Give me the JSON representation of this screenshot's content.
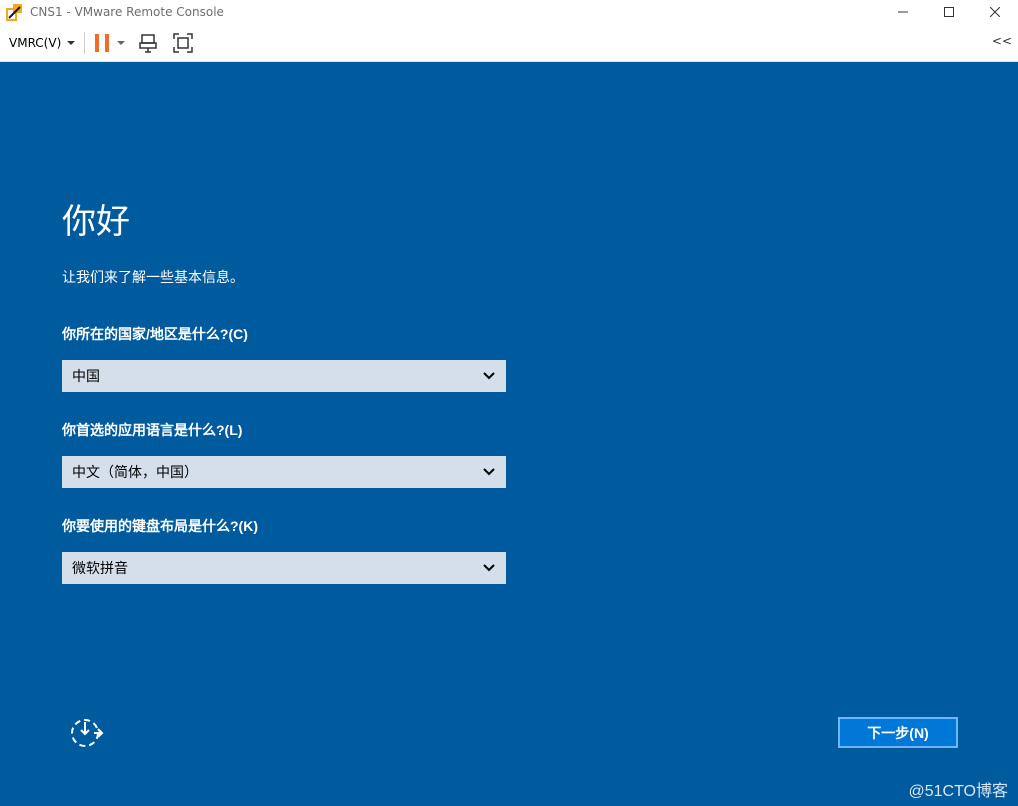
{
  "window": {
    "title": "CNS1 - VMware Remote Console",
    "controls": {
      "minimize_icon": "minimize-icon",
      "maximize_icon": "maximize-icon",
      "close_icon": "close-icon"
    }
  },
  "toolbar": {
    "vmrc_menu_label": "VMRC(V)",
    "pause_icon": "pause-icon",
    "send_ctrl_alt_del_icon": "send-ctrl-alt-del-icon",
    "fullscreen_icon": "fullscreen-icon",
    "collapse_label": "<<"
  },
  "setup": {
    "greeting": "你好",
    "subtitle": "让我们来了解一些基本信息。",
    "country": {
      "label": "你所在的国家/地区是什么?(C)",
      "value": "中国"
    },
    "language": {
      "label": "你首选的应用语言是什么?(L)",
      "value": "中文（简体，中国）"
    },
    "keyboard": {
      "label": "你要使用的键盘布局是什么?(K)",
      "value": "微软拼音"
    },
    "next_button": "下一步(N)",
    "accessibility_icon": "ease-of-access-icon"
  },
  "watermark": "@51CTO博客",
  "colors": {
    "console_bg": "#005a9e",
    "select_bg": "#d4dfea",
    "next_button_bg": "#0078d7",
    "pause_accent": "#f26b2a"
  }
}
